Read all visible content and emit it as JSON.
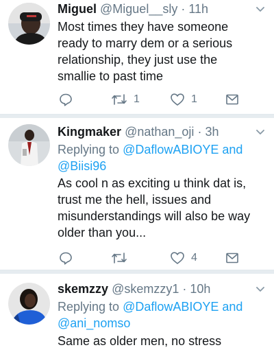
{
  "tweets": [
    {
      "name": "Miguel",
      "handle": "@Miguel__sly",
      "dot": "·",
      "time": "11h",
      "replying_prefix": "",
      "mention1": "",
      "mention_joiner": "",
      "mention2": "",
      "lines": [
        "Most times they have someone",
        "ready to marry dem or a serious",
        "relationship, they just use the",
        "smallie to past time"
      ],
      "reply_count": "",
      "retweet_count": "1",
      "like_count": "1"
    },
    {
      "name": "Kingmaker",
      "handle": "@nathan_oji",
      "dot": "·",
      "time": "3h",
      "replying_prefix": "Replying to ",
      "mention1": "@DaflowABIOYE",
      "mention_joiner": " and",
      "mention2": "@Biisi96",
      "lines": [
        "As cool n as exciting u think dat is,",
        "trust me the hell, issues and",
        "misunderstandings will also be way",
        "older than you..."
      ],
      "reply_count": "",
      "retweet_count": "",
      "like_count": "4"
    },
    {
      "name": "skemzzy",
      "handle": "@skemzzy1",
      "dot": "·",
      "time": "10h",
      "replying_prefix": "Replying to ",
      "mention1": "@DaflowABIOYE",
      "mention_joiner": " and",
      "mention2": "@ani_nomso",
      "lines": [
        "Same as older men, no stress"
      ]
    }
  ],
  "colors": {
    "text": "#14171a",
    "muted": "#657786",
    "link": "#1da1f2",
    "divider": "#e6ecf0"
  },
  "icons": [
    "reply-icon",
    "retweet-icon",
    "like-icon",
    "mail-icon",
    "chevron-down-icon"
  ]
}
